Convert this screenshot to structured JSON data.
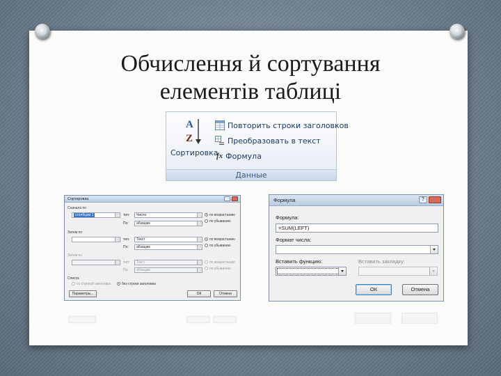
{
  "slide": {
    "title_line1": "Обчислення й сортування",
    "title_line2": "елементів таблиці"
  },
  "ribbon": {
    "sort_label": "Сортировка",
    "sort_glyph_top": "A",
    "sort_glyph_bottom": "Z",
    "repeat_header_label": "Повторить строки заголовков",
    "convert_label": "Преобразовать в текст",
    "formula_label": "Формула",
    "formula_glyph": "fx",
    "group_label": "Данные"
  },
  "sort_dialog": {
    "title": "Сортировка",
    "first_by_label": "Сначала по",
    "then_by_label_1": "Затем по",
    "then_by_label_2": "Затем по",
    "type_label": "тип:",
    "by_label": "По:",
    "row1": {
      "column": "столбцам 1",
      "type": "Число",
      "by": "абзацам",
      "asc": "по возрастанию",
      "desc": "по убыванию"
    },
    "row2": {
      "column": "",
      "type": "Текст",
      "by": "абзацам",
      "asc": "по возрастанию",
      "desc": "по убыванию"
    },
    "row3": {
      "column": "",
      "type": "Текст",
      "by": "абзацам",
      "asc": "по возрастанию",
      "desc": "по убыванию"
    },
    "list_label": "Список",
    "with_header": "со строкой заголовка",
    "without_header": "без строки заголовка",
    "params_button": "Параметры...",
    "ok_button": "ОК",
    "cancel_button": "Отмена"
  },
  "formula_dialog": {
    "title": "Формула",
    "help": "?",
    "formula_label": "Формула:",
    "formula_value": "=SUM(LEFT)",
    "number_format_label": "Формат числа:",
    "number_format_value": "",
    "paste_function_label": "Вставить функцию:",
    "paste_bookmark_label": "Вставить закладку:",
    "ok_button": "ОК",
    "cancel_button": "Отмена"
  }
}
